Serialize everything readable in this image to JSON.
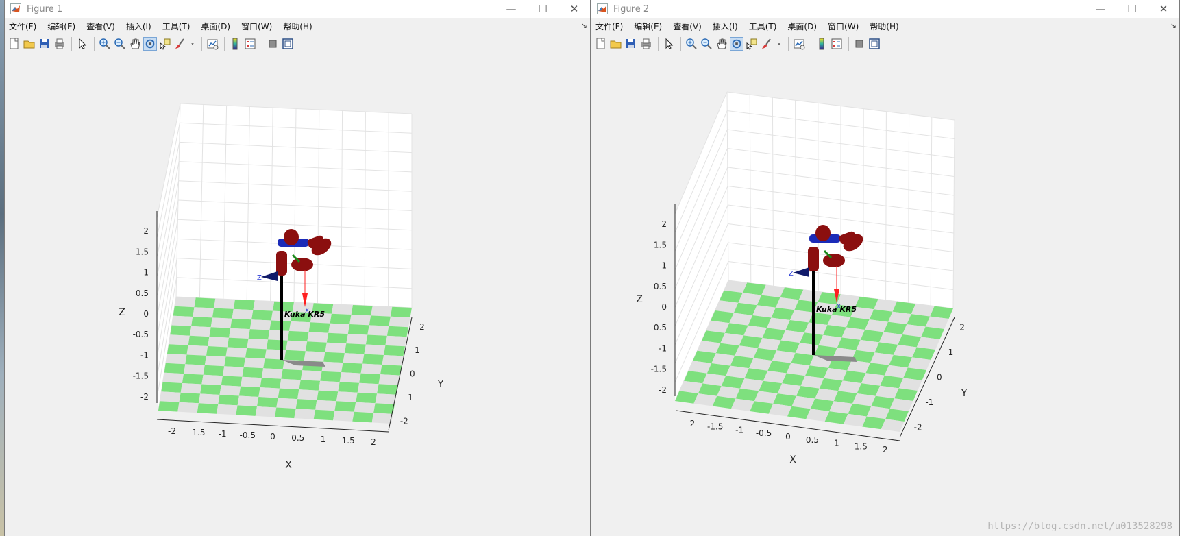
{
  "menu": [
    "文件(F)",
    "编辑(E)",
    "查看(V)",
    "插入(I)",
    "工具(T)",
    "桌面(D)",
    "窗口(W)",
    "帮助(H)"
  ],
  "toolbar_tools": [
    "new-figure",
    "open-file",
    "save",
    "print",
    "edit-plot",
    "zoom-in",
    "zoom-out",
    "pan",
    "rotate-3d",
    "data-cursor",
    "brush",
    "brush-menu",
    "link-plot",
    "insert-colorbar",
    "insert-legend",
    "hide-plot-tools",
    "show-plot-tools"
  ],
  "figures": [
    {
      "title": "Figure 1",
      "robot_label": "Kuka KR5",
      "frame_label_z": "Z",
      "frame_label_x": "X",
      "axes": {
        "xlabel": "X",
        "ylabel": "Y",
        "zlabel": "Z",
        "x_ticks": [
          "-2",
          "-1.5",
          "-1",
          "-0.5",
          "0",
          "0.5",
          "1",
          "1.5",
          "2"
        ],
        "y_ticks": [
          "-2",
          "-1",
          "0",
          "1",
          "2"
        ],
        "z_ticks": [
          "-2",
          "-1.5",
          "-1",
          "-0.5",
          "0",
          "0.5",
          "1",
          "1.5",
          "2"
        ]
      }
    },
    {
      "title": "Figure 2",
      "robot_label": "Kuka KR5",
      "frame_label_z": "Z",
      "frame_label_x": "X",
      "axes": {
        "xlabel": "X",
        "ylabel": "Y",
        "zlabel": "Z",
        "x_ticks": [
          "-2",
          "-1.5",
          "-1",
          "-0.5",
          "0",
          "0.5",
          "1",
          "1.5",
          "2"
        ],
        "y_ticks": [
          "-2",
          "-1",
          "0",
          "1",
          "2"
        ],
        "z_ticks": [
          "-2",
          "-1.5",
          "-1",
          "-0.5",
          "0",
          "0.5",
          "1",
          "1.5",
          "2"
        ]
      }
    }
  ],
  "watermark": "https://blog.csdn.net/u013528298",
  "colors": {
    "floor_green": "#7ee07e",
    "floor_gray": "#e1e1e1",
    "link_red": "#8b0f0f",
    "link_blue": "#1b2bb8",
    "frame_red": "#ff2020"
  }
}
